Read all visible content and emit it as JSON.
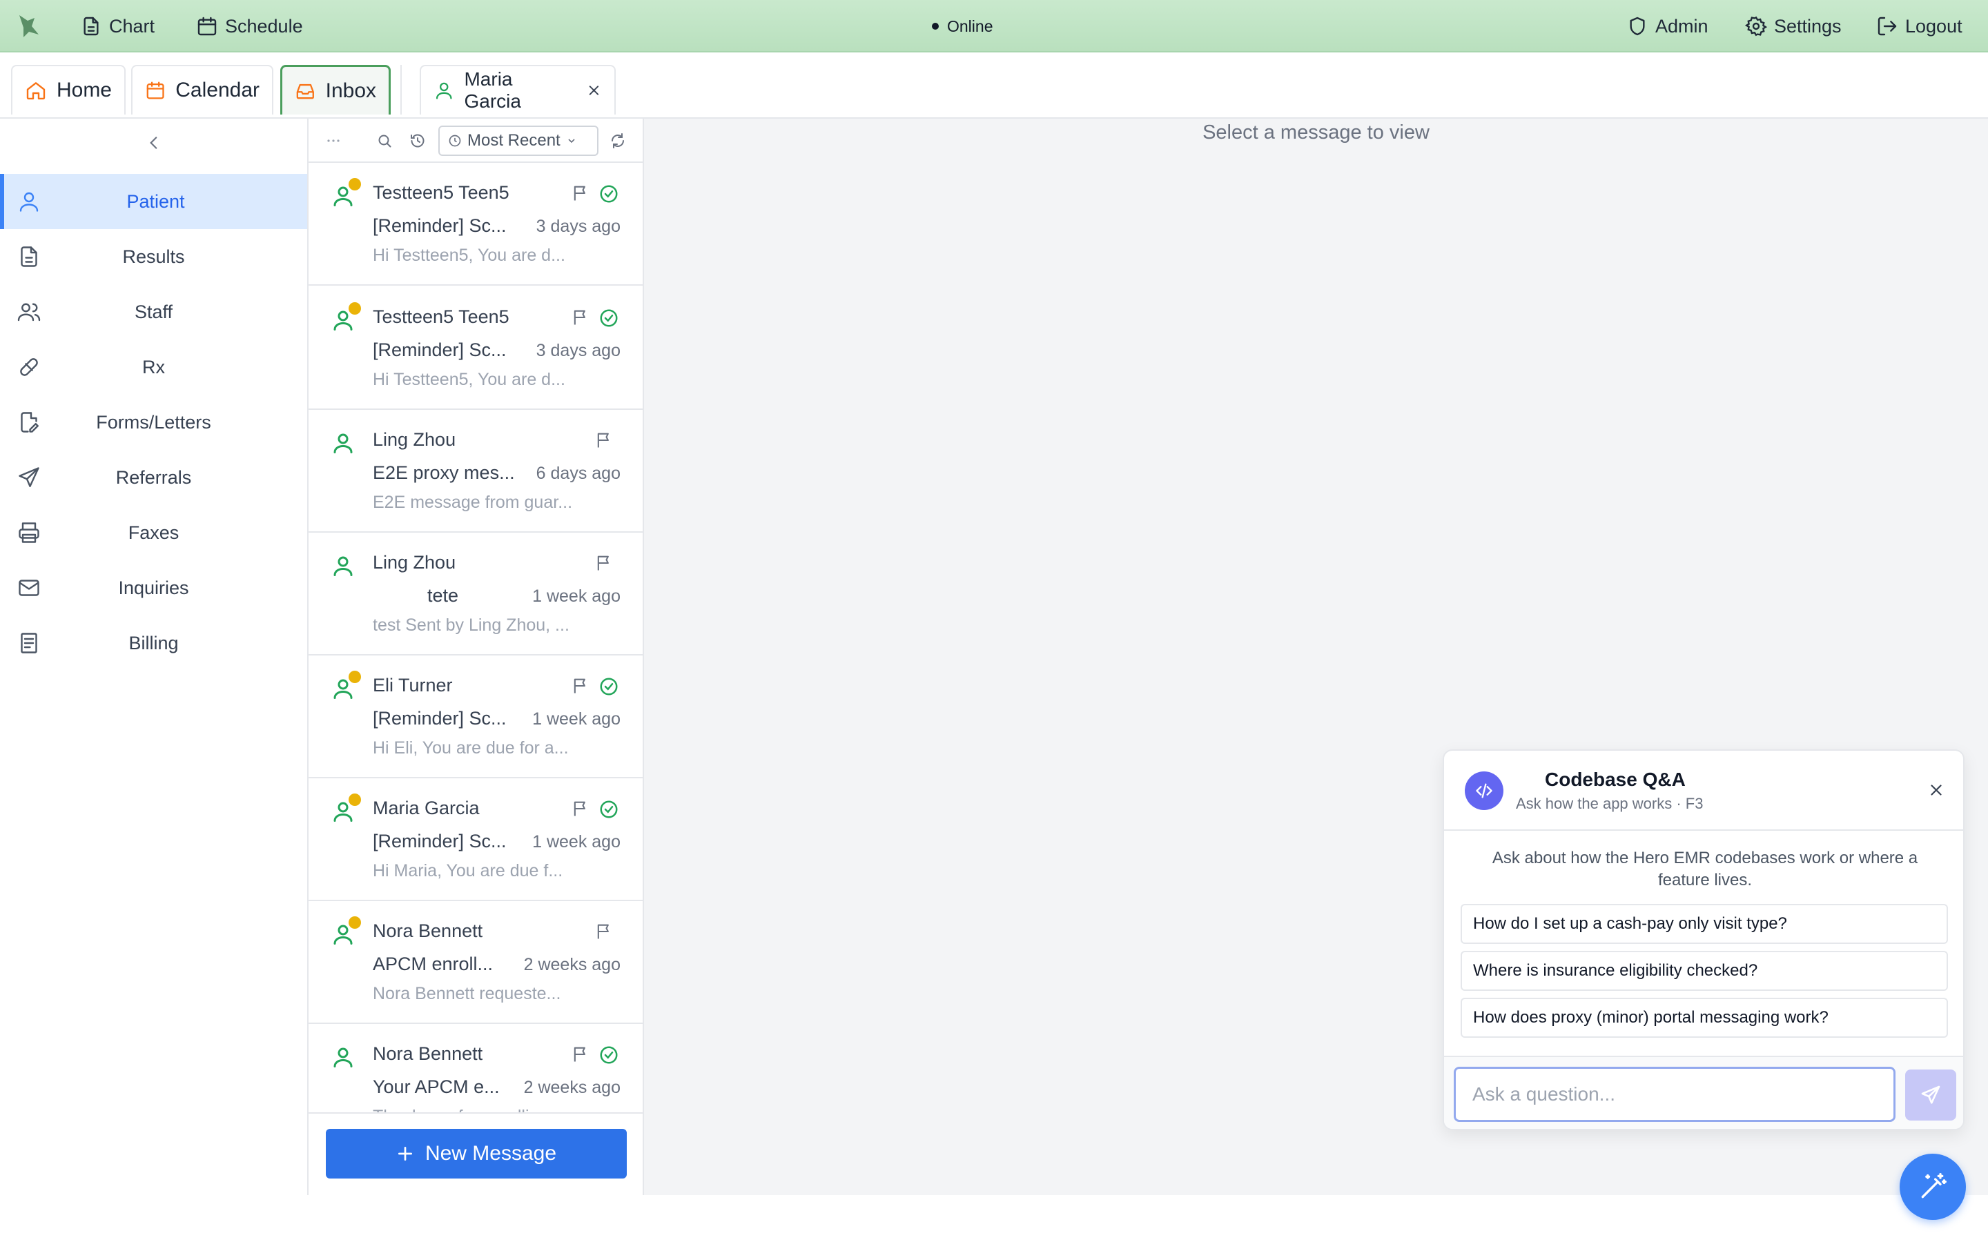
{
  "topbar": {
    "chart_label": "Chart",
    "schedule_label": "Schedule",
    "status": "Online",
    "admin_label": "Admin",
    "settings_label": "Settings",
    "logout_label": "Logout"
  },
  "tabs": {
    "home": "Home",
    "calendar": "Calendar",
    "inbox": "Inbox",
    "patient": "Maria Garcia"
  },
  "sidebar": {
    "items": [
      {
        "label": "Patient",
        "icon": "user-icon",
        "active": true
      },
      {
        "label": "Results",
        "icon": "document-icon"
      },
      {
        "label": "Staff",
        "icon": "users-icon"
      },
      {
        "label": "Rx",
        "icon": "pill-icon"
      },
      {
        "label": "Forms/Letters",
        "icon": "edit-document-icon"
      },
      {
        "label": "Referrals",
        "icon": "send-icon"
      },
      {
        "label": "Faxes",
        "icon": "printer-icon"
      },
      {
        "label": "Inquiries",
        "icon": "mail-icon"
      },
      {
        "label": "Billing",
        "icon": "receipt-icon"
      }
    ]
  },
  "inbox": {
    "sort_label": "Most Recent",
    "new_message_label": "New Message",
    "messages": [
      {
        "name": "Testteen5 Teen5",
        "subject": "[Reminder] Sc...",
        "time": "3 days ago",
        "preview": "Hi Testteen5, You are d...",
        "unread": true,
        "flagged_check": true
      },
      {
        "name": "Testteen5 Teen5",
        "subject": "[Reminder] Sc...",
        "time": "3 days ago",
        "preview": "Hi Testteen5, You are d...",
        "unread": true,
        "flagged_check": true
      },
      {
        "name": "Ling Zhou",
        "subject": "E2E proxy mes...",
        "time": "6 days ago",
        "preview": "E2E message from guar...",
        "unread": false,
        "flagged_check": false
      },
      {
        "name": "Ling Zhou",
        "subject": "tete",
        "time": "1 week ago",
        "preview": "test Sent by Ling Zhou, ...",
        "unread": false,
        "flagged_check": false
      },
      {
        "name": "Eli Turner",
        "subject": "[Reminder] Sc...",
        "time": "1 week ago",
        "preview": "Hi Eli, You are due for a...",
        "unread": true,
        "flagged_check": true
      },
      {
        "name": "Maria Garcia",
        "subject": "[Reminder] Sc...",
        "time": "1 week ago",
        "preview": "Hi Maria, You are due f...",
        "unread": true,
        "flagged_check": true
      },
      {
        "name": "Nora Bennett",
        "subject": "APCM enroll...",
        "time": "2 weeks ago",
        "preview": "Nora Bennett requeste...",
        "unread": true,
        "flagged_check": false
      },
      {
        "name": "Nora Bennett",
        "subject": "Your APCM e...",
        "time": "2 weeks ago",
        "preview": "Thank you for enrolli...",
        "unread": false,
        "flagged_check": true
      }
    ]
  },
  "main": {
    "placeholder": "Select a message to view"
  },
  "qa": {
    "title": "Codebase Q&A",
    "subtitle": "Ask how the app works · F3",
    "intro": "Ask about how the Hero EMR codebases work or where a feature lives.",
    "suggestions": [
      "How do I set up a cash-pay only visit type?",
      "Where is insurance eligibility checked?",
      "How does proxy (minor) portal messaging work?"
    ],
    "input_placeholder": "Ask a question..."
  },
  "colors": {
    "topbar": "#c9e9cd",
    "accent_green": "#22a559",
    "accent_blue": "#2d72e8",
    "unread_dot": "#eab308",
    "qa_purple": "#6366f1"
  }
}
